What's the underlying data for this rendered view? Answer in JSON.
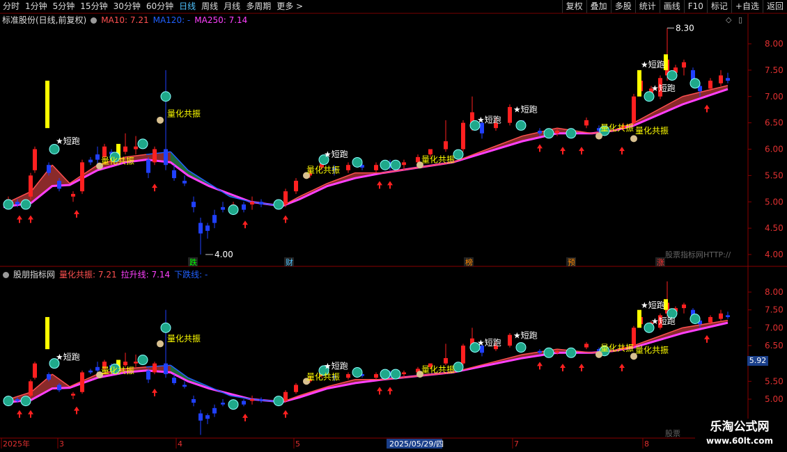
{
  "toolbar": {
    "periods": [
      "分时",
      "1分钟",
      "5分钟",
      "15分钟",
      "30分钟",
      "60分钟",
      "日线",
      "周线",
      "月线",
      "多周期",
      "更多 >"
    ],
    "active_index": 6,
    "right_buttons": [
      "复权",
      "叠加",
      "多股",
      "统计",
      "画线",
      "F10",
      "标记",
      "+自选",
      "返回"
    ]
  },
  "main_pane": {
    "title": "标准股份(日线,前复权)",
    "ma10_label": "MA10: 7.21",
    "ma120_label": "MA120: -",
    "ma250_label": "MA250: 7.14",
    "y_ticks": [
      "8.00",
      "7.50",
      "7.00",
      "6.50",
      "6.00",
      "5.50",
      "5.00",
      "4.50",
      "4.00"
    ],
    "high_label": "8.30",
    "low_label": "4.00",
    "watermark": "股票指标网HTTP://",
    "events": [
      {
        "text": "跌",
        "color": "#00ff00"
      },
      {
        "text": "财",
        "color": "#4fc3ff"
      },
      {
        "text": "榜",
        "color": "#ff8800"
      },
      {
        "text": "预",
        "color": "#ff8800"
      },
      {
        "text": "涨",
        "color": "#ff3030"
      }
    ]
  },
  "sub_pane": {
    "title": "股朋指标网",
    "line1_label": "量化共振: 7.21",
    "line2_label": "拉升线: 7.14",
    "line3_label": "下跌线: -",
    "y_ticks": [
      "8.00",
      "7.50",
      "7.00",
      "6.50",
      "5.50",
      "5.00"
    ],
    "current_price": "5.92",
    "watermark": "股票"
  },
  "x_axis": {
    "labels": [
      "2025年",
      "3",
      "4",
      "5",
      "2025/05/29/四",
      "7",
      "8"
    ]
  },
  "annotations": {
    "short_run": "短跑",
    "resonance": "量化共振"
  },
  "logo": {
    "line1": "乐淘公式网",
    "line2": "www.60lt.com"
  },
  "colors": {
    "up": "#ff2020",
    "down": "#2040ff",
    "ma10": "#ff5050",
    "ma120": "#2060ff",
    "ma250": "#ff40ff",
    "fill_up": "#8a2a2a",
    "fill_down": "#1f6b3a",
    "signal": "#ffff00"
  },
  "chart_data": {
    "type": "line",
    "title": "标准股份(日线,前复权)",
    "xlabel": "",
    "ylabel": "",
    "ylim": [
      4.0,
      8.3
    ],
    "series": [
      {
        "name": "MA10",
        "values": [
          4.95,
          5.2,
          5.7,
          5.35,
          5.7,
          5.85,
          5.9,
          5.95,
          5.6,
          5.35,
          5.1,
          5.0,
          4.92,
          5.1,
          5.35,
          5.55,
          5.55,
          5.65,
          5.75,
          6.0,
          6.25,
          6.4,
          6.3,
          6.35,
          6.5,
          7.0,
          7.21
        ]
      },
      {
        "name": "MA250",
        "values": [
          4.9,
          4.98,
          5.3,
          5.32,
          5.6,
          5.75,
          5.8,
          5.75,
          5.5,
          5.3,
          5.15,
          5.0,
          4.92,
          5.05,
          5.3,
          5.45,
          5.55,
          5.65,
          5.75,
          5.95,
          6.15,
          6.3,
          6.3,
          6.35,
          6.45,
          6.85,
          7.14
        ]
      }
    ],
    "extremes": {
      "high": 8.3,
      "low": 4.0
    }
  }
}
